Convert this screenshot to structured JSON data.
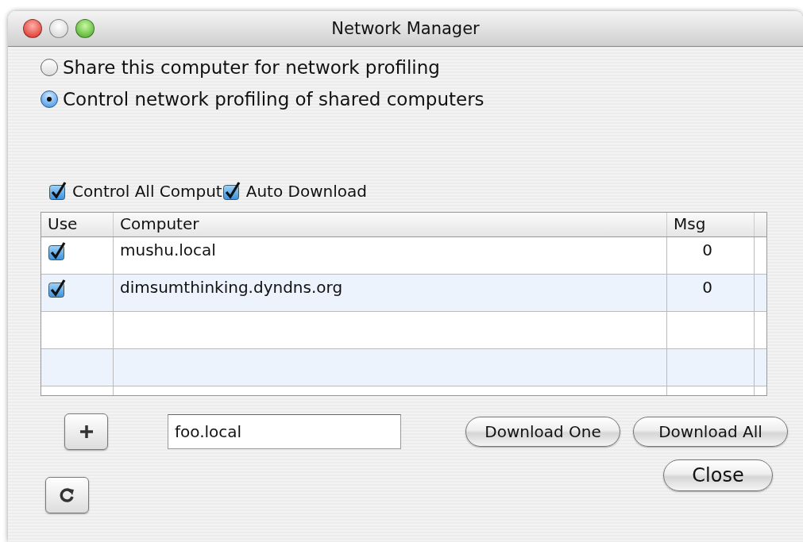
{
  "window": {
    "title": "Network Manager"
  },
  "modes": [
    {
      "label": "Share this computer for network profiling",
      "selected": false
    },
    {
      "label": "Control network profiling of shared computers",
      "selected": true
    }
  ],
  "options": [
    {
      "label": "Control All Comput",
      "checked": true
    },
    {
      "label": "Auto Download",
      "checked": true
    }
  ],
  "table": {
    "columns": [
      "Use",
      "Computer",
      "Msg"
    ],
    "rows": [
      {
        "checked": true,
        "computer": "mushu.local",
        "msg": "0"
      },
      {
        "checked": true,
        "computer": "dimsumthinking.dyndns.org",
        "msg": "0"
      }
    ]
  },
  "host_field": {
    "value": "foo.local"
  },
  "buttons": [
    "Download One",
    "Download All"
  ],
  "close_button": "Close"
}
